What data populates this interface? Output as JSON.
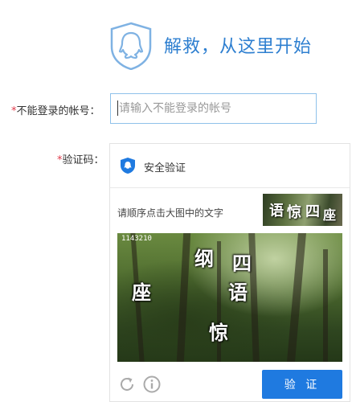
{
  "brand": {
    "title": "解救，从这里开始",
    "icon": "qq-penguin-icon"
  },
  "form": {
    "account_label": "不能登录的帐号：",
    "required_mark": "*",
    "account_placeholder": "请输入不能登录的帐号",
    "captcha_label": "验证码："
  },
  "verify": {
    "title": "安全验证",
    "instruction": "请顺序点击大图中的文字",
    "target_chars": [
      "语",
      "惊",
      "四",
      "座"
    ],
    "image_id": "1143210",
    "captcha_chars": [
      "纲",
      "四",
      "座",
      "语",
      "惊"
    ],
    "button_label": "验 证",
    "icons": [
      "shield-icon",
      "refresh-icon",
      "info-icon"
    ]
  },
  "colors": {
    "accent": "#2e7fd0",
    "button": "#1f7ae0",
    "required": "#e0394a",
    "input_border": "#8fc1ea"
  }
}
